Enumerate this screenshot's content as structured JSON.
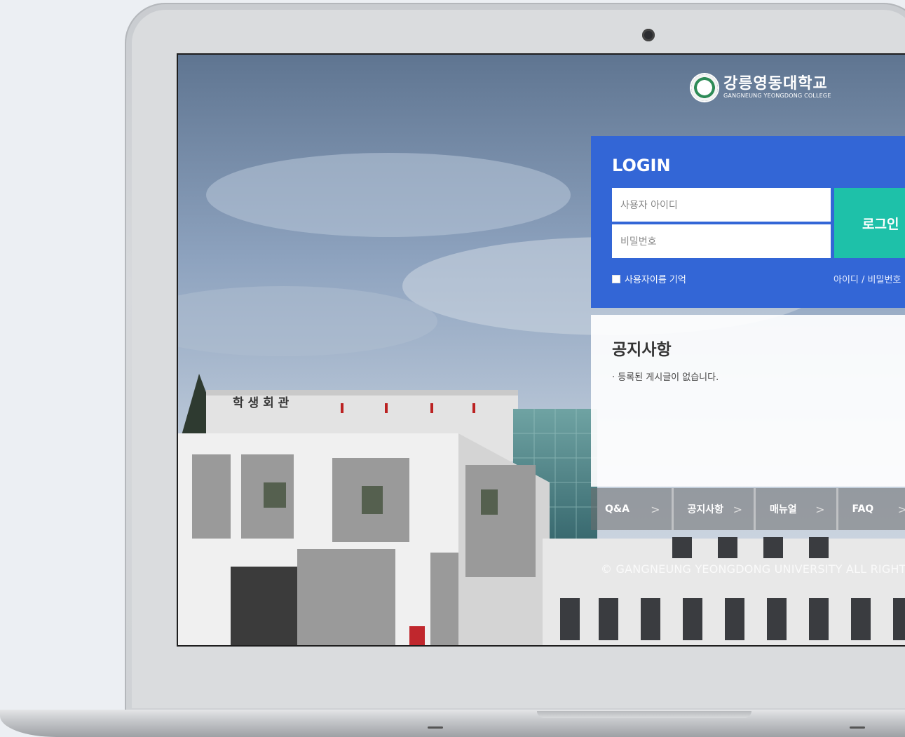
{
  "logo": {
    "name": "강릉영동대학교",
    "subtitle": "GANGNEUNG YEONGDONG COLLEGE"
  },
  "login": {
    "title": "LOGIN",
    "username_placeholder": "사용자 아이디",
    "password_placeholder": "비밀번호",
    "submit_label": "로그인",
    "remember_label": "사용자이름 기억",
    "remember_checked": false,
    "find_label": "아이디 / 비밀번호"
  },
  "notice": {
    "title": "공지사항",
    "empty_message": "· 등록된 게시글이 없습니다."
  },
  "quicklinks": [
    {
      "label": "Q&A",
      "arrow": ">"
    },
    {
      "label": "공지사항",
      "arrow": ">"
    },
    {
      "label": "매뉴얼",
      "arrow": ">"
    },
    {
      "label": "FAQ",
      "arrow": ">"
    }
  ],
  "building_sign": "학 생 회 관",
  "footer": {
    "copyright": "© GANGNEUNG YEONGDONG UNIVERSITY ALL RIGHT RESERVED"
  },
  "colors": {
    "login_panel": "#3366d6",
    "login_button": "#1ec1a9"
  }
}
